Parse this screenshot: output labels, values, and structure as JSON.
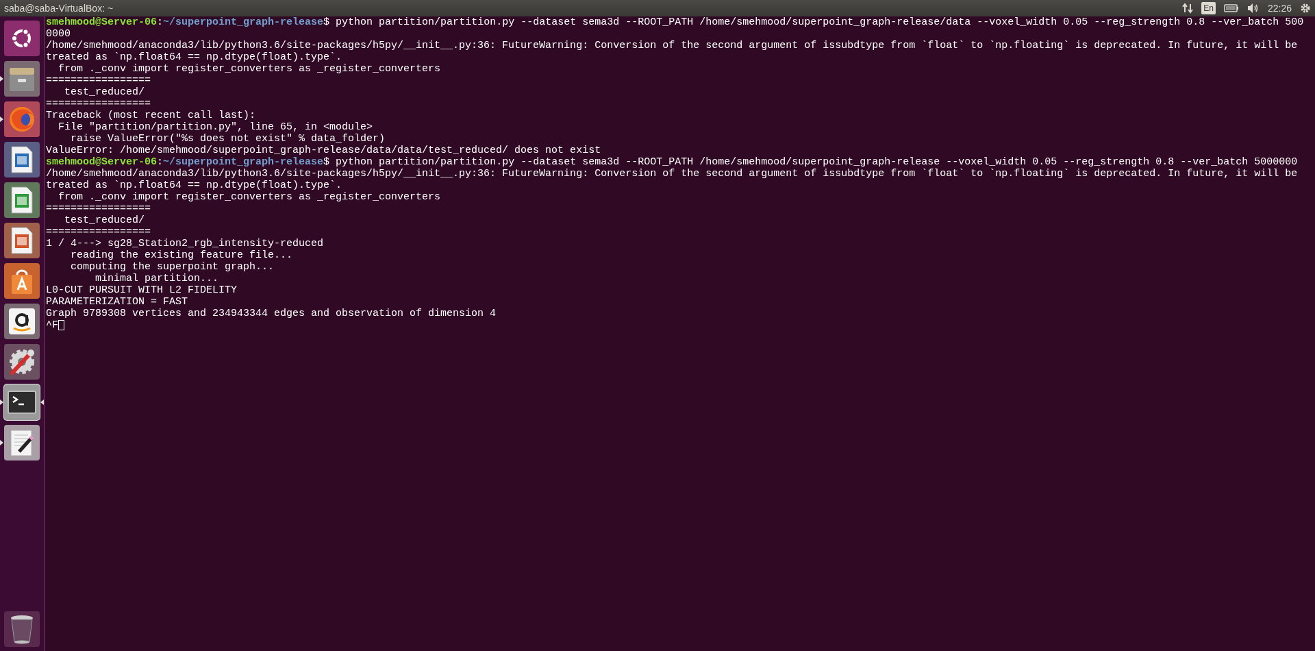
{
  "top_bar": {
    "title": "saba@saba-VirtualBox: ~",
    "keyboard_layout": "En",
    "time": "22:26"
  },
  "launcher": {
    "items": [
      {
        "kind": "dash",
        "running": false,
        "focused": false
      },
      {
        "kind": "files",
        "running": true,
        "focused": false
      },
      {
        "kind": "firefox",
        "running": true,
        "focused": false
      },
      {
        "kind": "writer",
        "running": false,
        "focused": false
      },
      {
        "kind": "calc",
        "running": false,
        "focused": false
      },
      {
        "kind": "impress",
        "running": false,
        "focused": false
      },
      {
        "kind": "software",
        "running": false,
        "focused": false
      },
      {
        "kind": "amazon",
        "running": false,
        "focused": false
      },
      {
        "kind": "settings",
        "running": false,
        "focused": false
      },
      {
        "kind": "terminal",
        "running": true,
        "focused": true
      },
      {
        "kind": "editor",
        "running": true,
        "focused": false
      }
    ],
    "trash": {
      "kind": "trash"
    }
  },
  "terminal": {
    "lines": [
      {
        "kind": "prompt",
        "user": "smehmood@Server-06",
        "separator": ":",
        "path": "~/superpoint_graph-release",
        "command": "$ python partition/partition.py --dataset sema3d --ROOT_PATH /home/smehmood/superpoint_graph-release/data --voxel_width 0.05 --reg_strength 0.8 --ver_batch 500"
      },
      {
        "kind": "output",
        "text": "0000"
      },
      {
        "kind": "output",
        "text": "/home/smehmood/anaconda3/lib/python3.6/site-packages/h5py/__init__.py:36: FutureWarning: Conversion of the second argument of issubdtype from `float` to `np.floating` is deprecated. In future, it will be"
      },
      {
        "kind": "output",
        "text": "treated as `np.float64 == np.dtype(float).type`."
      },
      {
        "kind": "output",
        "text": "  from ._conv import register_converters as _register_converters"
      },
      {
        "kind": "output",
        "text": "================="
      },
      {
        "kind": "output",
        "text": "   test_reduced/"
      },
      {
        "kind": "output",
        "text": "================="
      },
      {
        "kind": "output",
        "text": "Traceback (most recent call last):"
      },
      {
        "kind": "output",
        "text": "  File \"partition/partition.py\", line 65, in <module>"
      },
      {
        "kind": "output",
        "text": "    raise ValueError(\"%s does not exist\" % data_folder)"
      },
      {
        "kind": "output",
        "text": "ValueError: /home/smehmood/superpoint_graph-release/data/data/test_reduced/ does not exist"
      },
      {
        "kind": "prompt",
        "user": "smehmood@Server-06",
        "separator": ":",
        "path": "~/superpoint_graph-release",
        "command": "$ python partition/partition.py --dataset sema3d --ROOT_PATH /home/smehmood/superpoint_graph-release --voxel_width 0.05 --reg_strength 0.8 --ver_batch 5000000"
      },
      {
        "kind": "output",
        "text": "/home/smehmood/anaconda3/lib/python3.6/site-packages/h5py/__init__.py:36: FutureWarning: Conversion of the second argument of issubdtype from `float` to `np.floating` is deprecated. In future, it will be"
      },
      {
        "kind": "output",
        "text": "treated as `np.float64 == np.dtype(float).type`."
      },
      {
        "kind": "output",
        "text": "  from ._conv import register_converters as _register_converters"
      },
      {
        "kind": "output",
        "text": "================="
      },
      {
        "kind": "output",
        "text": "   test_reduced/"
      },
      {
        "kind": "output",
        "text": "================="
      },
      {
        "kind": "output",
        "text": "1 / 4---> sg28_Station2_rgb_intensity-reduced"
      },
      {
        "kind": "output",
        "text": "    reading the existing feature file..."
      },
      {
        "kind": "output",
        "text": "    computing the superpoint graph..."
      },
      {
        "kind": "output",
        "text": "        minimal partition..."
      },
      {
        "kind": "output",
        "text": "L0-CUT PURSUIT WITH L2 FIDELITY"
      },
      {
        "kind": "output",
        "text": "PARAMETERIZATION = FAST"
      },
      {
        "kind": "output",
        "text": "Graph 9789308 vertices and 234943344 edges and observation of dimension 4"
      },
      {
        "kind": "input",
        "text": "^F"
      }
    ]
  }
}
